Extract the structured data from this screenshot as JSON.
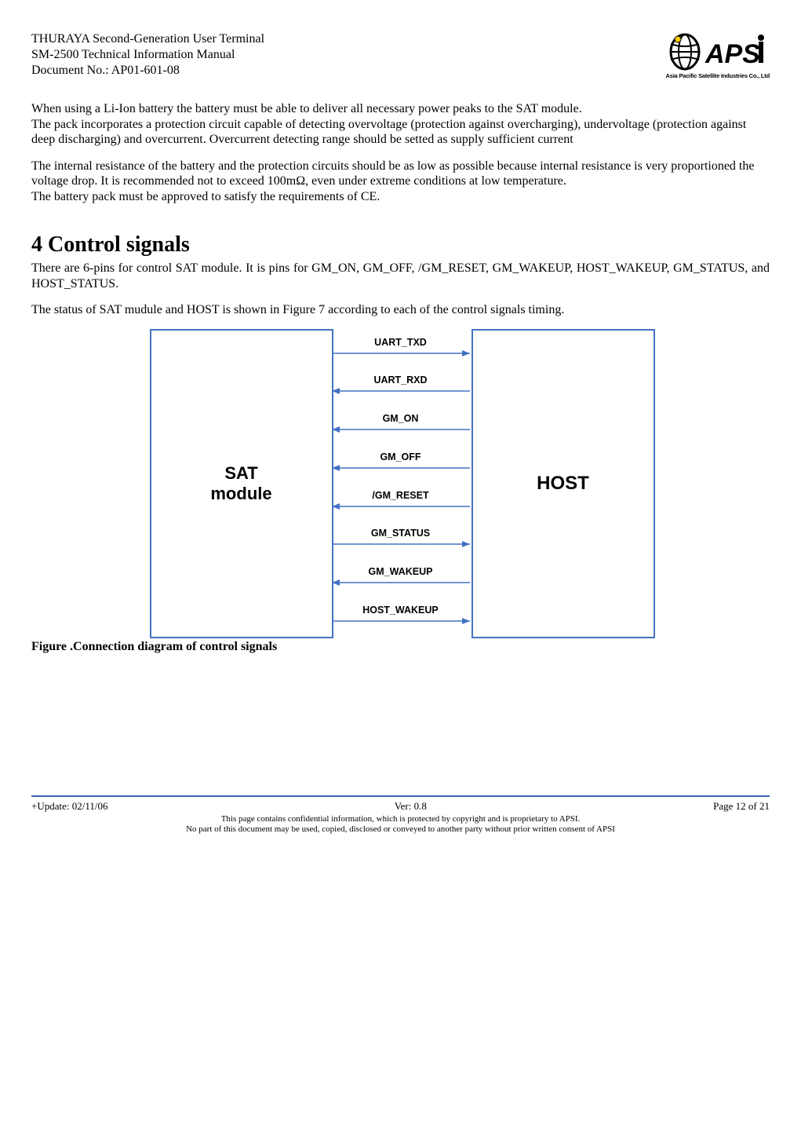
{
  "header": {
    "line1": "THURAYA Second-Generation User Terminal",
    "line2": "SM-2500 Technical Information Manual",
    "line3": "Document No.: AP01-601-08",
    "logo_top": "APSı",
    "logo_bottom": "Asia Pacific Satellite Industries Co., Ltd"
  },
  "body": {
    "p1": "When using a Li-Ion battery the battery must be able to deliver all necessary power peaks to the SAT module.",
    "p2": "The pack incorporates a protection circuit capable of detecting overvoltage (protection against overcharging), undervoltage (protection against deep discharging) and overcurrent. Overcurrent detecting range should be setted as supply sufficient current",
    "p3": "The internal resistance of the battery and the protection circuits should be as low as possible because internal resistance is very proportioned the voltage drop. It is recommended not to exceed 100mΩ, even under extreme conditions at low temperature.",
    "p4": "The battery pack must be approved to satisfy the requirements of CE."
  },
  "section": {
    "title": "4  Control signals",
    "para1": "There are 6-pins for control SAT module. It is pins for GM_ON, GM_OFF, /GM_RESET, GM_WAKEUP, HOST_WAKEUP, GM_STATUS, and HOST_STATUS.",
    "para2": "The status of SAT mudule and HOST is shown in Figure 7 according to each of the control signals timing."
  },
  "diagram": {
    "left_label_1": "SAT",
    "left_label_2": "module",
    "right_label": "HOST",
    "signals": [
      {
        "label": "UART_TXD",
        "dir": "right"
      },
      {
        "label": "UART_RXD",
        "dir": "left"
      },
      {
        "label": "GM_ON",
        "dir": "left"
      },
      {
        "label": "GM_OFF",
        "dir": "left"
      },
      {
        "label": "/GM_RESET",
        "dir": "left"
      },
      {
        "label": "GM_STATUS",
        "dir": "right"
      },
      {
        "label": "GM_WAKEUP",
        "dir": "left"
      },
      {
        "label": "HOST_WAKEUP",
        "dir": "right"
      }
    ]
  },
  "figure_caption": "Figure .Connection diagram of control signals",
  "footer": {
    "left": "+Update: 02/11/06",
    "center": "Ver: 0.8",
    "right": "Page 12 of 21",
    "small1": "This page contains confidential information, which is protected by copyright and is proprietary to APSI.",
    "small2": "No part of this document may be used, copied, disclosed or conveyed to another party without prior written consent of APSI"
  },
  "chart_data": {
    "type": "diagram",
    "title": "Connection diagram of control signals",
    "nodes": [
      "SAT module",
      "HOST"
    ],
    "edges": [
      {
        "from": "SAT module",
        "to": "HOST",
        "label": "UART_TXD"
      },
      {
        "from": "HOST",
        "to": "SAT module",
        "label": "UART_RXD"
      },
      {
        "from": "HOST",
        "to": "SAT module",
        "label": "GM_ON"
      },
      {
        "from": "HOST",
        "to": "SAT module",
        "label": "GM_OFF"
      },
      {
        "from": "HOST",
        "to": "SAT module",
        "label": "/GM_RESET"
      },
      {
        "from": "SAT module",
        "to": "HOST",
        "label": "GM_STATUS"
      },
      {
        "from": "HOST",
        "to": "SAT module",
        "label": "GM_WAKEUP"
      },
      {
        "from": "SAT module",
        "to": "HOST",
        "label": "HOST_WAKEUP"
      }
    ]
  }
}
